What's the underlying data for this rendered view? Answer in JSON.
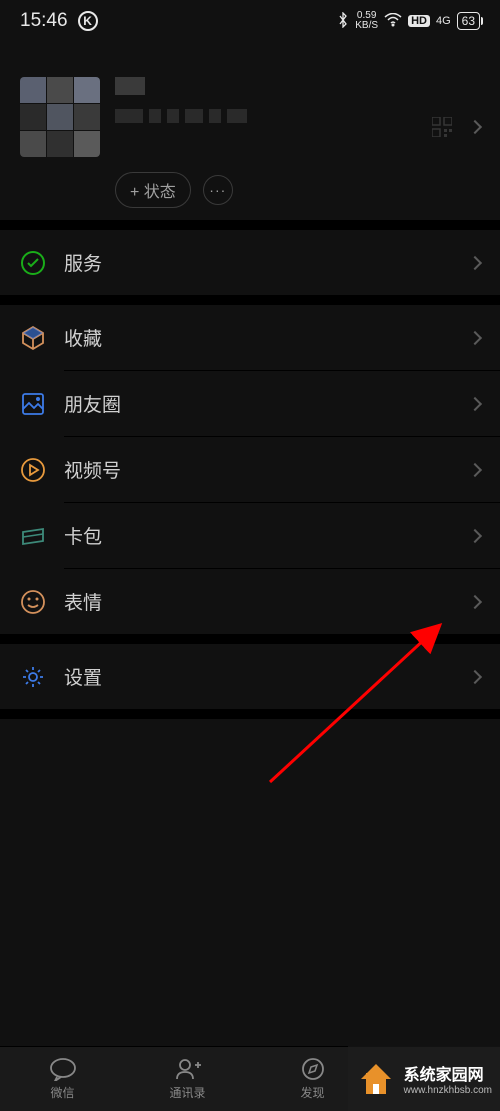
{
  "status_bar": {
    "time": "15:46",
    "k_badge": "K",
    "net_speed_top": "0.59",
    "net_speed_bottom": "KB/S",
    "hd_label": "HD",
    "net_type": "4G",
    "battery": "63"
  },
  "profile": {
    "status_btn": "+ 状态",
    "more": "···"
  },
  "menu": {
    "service": "服务",
    "favorites": "收藏",
    "moments": "朋友圈",
    "channels": "视频号",
    "cards": "卡包",
    "stickers": "表情",
    "settings": "设置"
  },
  "nav": {
    "chat": "微信",
    "contacts": "通讯录",
    "discover": "发现"
  },
  "watermark": {
    "name": "系统家园网",
    "url": "www.hnzkhbsb.com"
  },
  "icons": {
    "service_color": "#1aad19",
    "favorites_color": "#d4915c",
    "moments_color": "#3d7be8",
    "channels_color": "#e89a3d",
    "cards_color": "#3d8a7a",
    "stickers_color": "#d4915c",
    "settings_color": "#3d7be8"
  }
}
